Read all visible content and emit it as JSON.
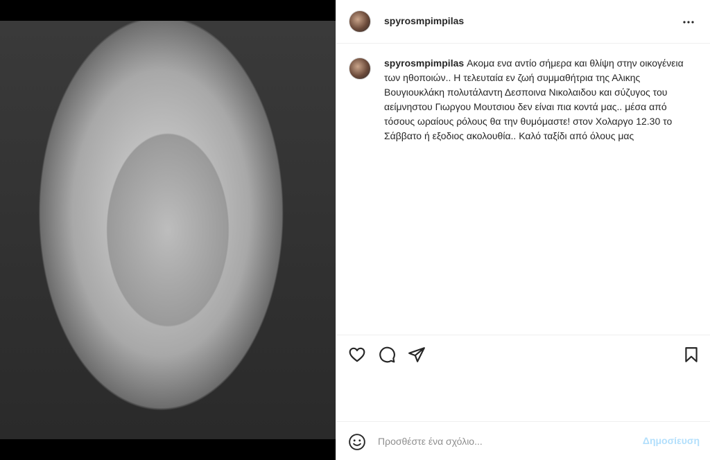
{
  "post": {
    "username": "spyrosmpimpilas",
    "caption_text": "Ακομα ενα αντίο σήμερα και θλίψη στην οικογένεια των ηθοποιών.. Η τελευταία εν ζωή συμμαθήτρια της Αλικης Βουγιουκλάκη πολυτάλαντη Δεσποινα Νικολαιδου και σύζυγος του αείμνηστου Γιωργου Μουτσιου δεν είναι πια κοντά μας.. μέσα από τόσους ωραίους ρόλους θα την θυμόμαστε! στον Χολαργο 12.30 το Σάββατο ή εξοδιος ακολουθία.. Καλό ταξίδι από όλους μας"
  },
  "icons": {
    "more": "more-options-icon",
    "like": "heart-icon",
    "comment": "comment-bubble-icon",
    "share": "paper-plane-icon",
    "save": "bookmark-icon",
    "emoji": "emoji-smiley-icon"
  },
  "add_comment": {
    "placeholder": "Προσθέστε ένα σχόλιο...",
    "post_label": "Δημοσίευση"
  },
  "colors": {
    "post_button_disabled": "#b2dffc",
    "text": "#262626",
    "placeholder": "#8e8e8e",
    "divider": "#efefef"
  }
}
